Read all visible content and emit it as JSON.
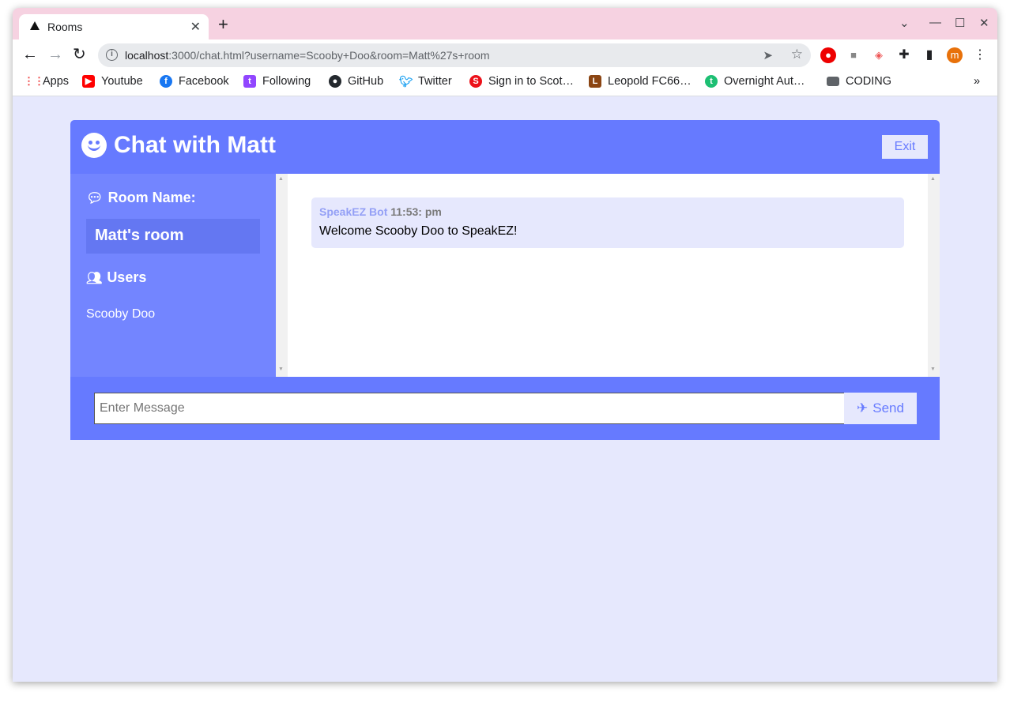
{
  "browser": {
    "tab_title": "Rooms",
    "tab_close": "✕",
    "new_tab": "+",
    "url_host": "localhost",
    "url_rest": ":3000/chat.html?username=Scooby+Doo&room=Matt%27s+room",
    "profile_initial": "m"
  },
  "bookmarks": [
    {
      "label": "Apps",
      "icon": "apps-grid-icon",
      "color": "#4285f4"
    },
    {
      "label": "Youtube",
      "icon": "youtube-icon",
      "color": "#ff0000"
    },
    {
      "label": "Facebook",
      "icon": "facebook-icon",
      "color": "#1877f2"
    },
    {
      "label": "Following",
      "icon": "twitch-icon",
      "color": "#9146ff"
    },
    {
      "label": "GitHub",
      "icon": "github-icon",
      "color": "#24292e"
    },
    {
      "label": "Twitter",
      "icon": "twitter-icon",
      "color": "#1da1f2"
    },
    {
      "label": "Sign in to Scot…",
      "icon": "scotiabank-icon",
      "color": "#ec111a"
    },
    {
      "label": "Leopold FC66…",
      "icon": "leopold-icon",
      "color": "#8b4513"
    },
    {
      "label": "Overnight Aut…",
      "icon": "overnight-icon",
      "color": "#1dbf73"
    },
    {
      "label": "CODING",
      "icon": "folder-icon",
      "color": "#5f6368"
    }
  ],
  "bookmarks_overflow": "»",
  "chat": {
    "title": "Chat with Matt",
    "exit_label": "Exit",
    "room_heading": "Room Name:",
    "room_name": "Matt's room",
    "users_heading": "Users",
    "users": [
      "Scooby Doo"
    ],
    "messages": [
      {
        "author": "SpeakEZ Bot",
        "time": "11:53: pm",
        "text": "Welcome Scooby Doo to SpeakEZ!"
      }
    ],
    "input_placeholder": "Enter Message",
    "send_label": "Send"
  },
  "colors": {
    "accent": "#667aff",
    "sidebar": "#7385ff",
    "page_bg": "#e6e8fd"
  }
}
